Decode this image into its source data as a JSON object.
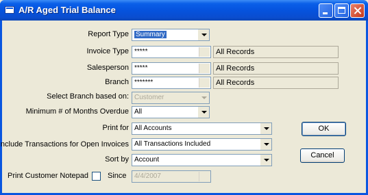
{
  "window": {
    "title": "A/R Aged Trial Balance"
  },
  "labels": {
    "report_type": "Report Type",
    "invoice_type": "Invoice Type",
    "salesperson": "Salesperson",
    "branch": "Branch",
    "select_branch": "Select Branch based on:",
    "min_months": "Minimum # of Months Overdue",
    "print_for": "Print for",
    "include_trans": "Include Transactions for Open Invoices",
    "sort_by": "Sort by",
    "print_notepad": "Print Customer Notepad",
    "since": "Since"
  },
  "fields": {
    "report_type": "Summary",
    "invoice_type": "*****",
    "invoice_type_desc": "All Records",
    "salesperson": "*****",
    "salesperson_desc": "All Records",
    "branch": "*******",
    "branch_desc": "All Records",
    "select_branch": "Customer",
    "min_months": "All",
    "print_for": "All Accounts",
    "include_trans": "All Transactions Included",
    "sort_by": "Account",
    "since": "4/4/2007"
  },
  "buttons": {
    "ok": "OK",
    "cancel": "Cancel"
  }
}
